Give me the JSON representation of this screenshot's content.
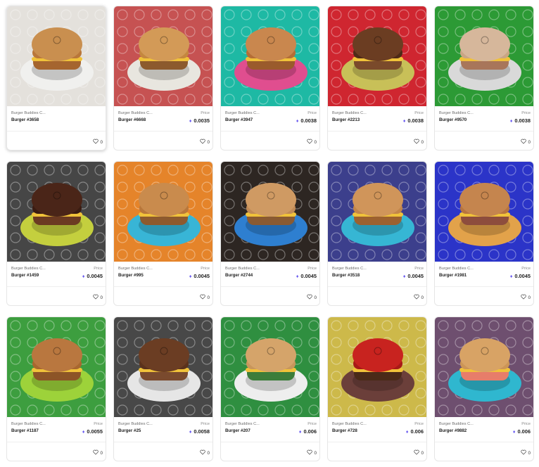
{
  "labels": {
    "collection": "Burger Buddies C...",
    "price_label": "Price"
  },
  "icons": {
    "currency": "eth-icon",
    "like": "heart-icon"
  },
  "cards": [
    {
      "name": "Burger #3658",
      "price": "",
      "likes": "0",
      "bg": "#e4e1dc",
      "plate": "#f0f0ee",
      "bun": "#c98f4f",
      "top": "#b9773a",
      "mid": "#a5652f"
    },
    {
      "name": "Burger #6668",
      "price": "0.0035",
      "likes": "0",
      "bg": "#c65252",
      "plate": "#e8e6df",
      "bun": "#d39a57",
      "top": "#c4873f",
      "mid": "#8c5a2d"
    },
    {
      "name": "Burger #3947",
      "price": "0.0038",
      "likes": "0",
      "bg": "#1eb9a4",
      "plate": "#e04e8f",
      "bun": "#c9874e",
      "top": "#b46e36",
      "mid": "#9a5b2c"
    },
    {
      "name": "Burger #2213",
      "price": "0.0038",
      "likes": "0",
      "bg": "#cf2630",
      "plate": "#c8c058",
      "bun": "#6b3d22",
      "top": "#4e2a17",
      "mid": "#7a4a2b"
    },
    {
      "name": "Burger #9570",
      "price": "0.0038",
      "likes": "0",
      "bg": "#2c9a35",
      "plate": "#d9d9d9",
      "bun": "#d6b79b",
      "top": "#c9a584",
      "mid": "#a8765a"
    },
    {
      "name": "Burger #1459",
      "price": "0.0045",
      "likes": "0",
      "bg": "#464646",
      "plate": "#c4cf3e",
      "bun": "#4a2518",
      "top": "#3a1c12",
      "mid": "#6b3a22"
    },
    {
      "name": "Burger #995",
      "price": "0.0045",
      "likes": "0",
      "bg": "#e5842a",
      "plate": "#38b5d6",
      "bun": "#c98b4d",
      "top": "#b8773b",
      "mid": "#8d5a2e"
    },
    {
      "name": "Burger #2744",
      "price": "0.0045",
      "likes": "0",
      "bg": "#2d2622",
      "plate": "#2e7fd0",
      "bun": "#cf9a63",
      "top": "#c08a56",
      "mid": "#8a5a31"
    },
    {
      "name": "Burger #3518",
      "price": "0.0045",
      "likes": "0",
      "bg": "#3c3f8c",
      "plate": "#36b6d4",
      "bun": "#d0955a",
      "top": "#c3864a",
      "mid": "#9c612f"
    },
    {
      "name": "Burger #1981",
      "price": "0.0045",
      "likes": "0",
      "bg": "#2b34c8",
      "plate": "#e2a24a",
      "bun": "#c5854e",
      "top": "#b7743f",
      "mid": "#8d4d3d"
    },
    {
      "name": "Burger #1187",
      "price": "0.0055",
      "likes": "0",
      "bg": "#3d9e3f",
      "plate": "#9dd23a",
      "bun": "#b9773f",
      "top": "#a8672f",
      "mid": "#8c5427"
    },
    {
      "name": "Burger #25",
      "price": "0.0058",
      "likes": "0",
      "bg": "#484848",
      "plate": "#e6e6e6",
      "bun": "#6b3d23",
      "top": "#5b321c",
      "mid": "#7a4a2e"
    },
    {
      "name": "Burger #207",
      "price": "0.006",
      "likes": "0",
      "bg": "#2f8f40",
      "plate": "#eeeeee",
      "bun": "#d5a46a",
      "top": "#c8965b",
      "mid": "#3c7d3a"
    },
    {
      "name": "Burger #728",
      "price": "0.006",
      "likes": "0",
      "bg": "#cdb94a",
      "plate": "#6b3f3a",
      "bun": "#c8231f",
      "top": "#a81a17",
      "mid": "#4a2a18"
    },
    {
      "name": "Burger #9882",
      "price": "0.006",
      "likes": "0",
      "bg": "#6e4f6f",
      "plate": "#2fb7cf",
      "bun": "#d8a365",
      "top": "#cc9556",
      "mid": "#e77d6a"
    }
  ]
}
